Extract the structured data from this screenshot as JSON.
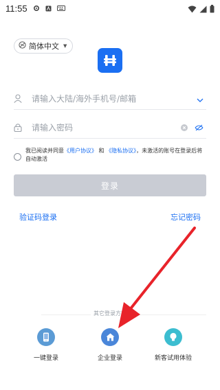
{
  "status_bar": {
    "time": "11:55"
  },
  "language": {
    "label": "简体中文"
  },
  "account": {
    "placeholder": "请输入大陆/海外手机号/邮箱"
  },
  "password": {
    "placeholder": "请输入密码"
  },
  "agreement": {
    "prefix": "我已阅读并同意",
    "user_agreement": "《用户协议》",
    "and": "和",
    "privacy_policy": "《隐私协议》",
    "suffix": "，未激活的账号在登录后将自动激活"
  },
  "login_button": "登录",
  "links": {
    "sms_login": "验证码登录",
    "forgot_password": "忘记密码"
  },
  "other_login": {
    "title": "其它登录方式",
    "options": [
      {
        "label": "一键登录",
        "icon": "phone-icon",
        "color": "#5b9bd5"
      },
      {
        "label": "企业登录",
        "icon": "home-icon",
        "color": "#4a86d9"
      },
      {
        "label": "新客试用体验",
        "icon": "bulb-icon",
        "color": "#3cbdd0"
      }
    ]
  },
  "colors": {
    "brand": "#1b6ff2",
    "annotation_arrow": "#e8232a"
  }
}
